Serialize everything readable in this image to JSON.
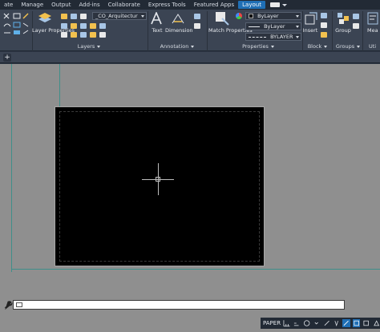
{
  "tabs": [
    {
      "label": "ate",
      "active": false
    },
    {
      "label": "Manage",
      "active": false
    },
    {
      "label": "Output",
      "active": false
    },
    {
      "label": "Add-ins",
      "active": false
    },
    {
      "label": "Collaborate",
      "active": false
    },
    {
      "label": "Express Tools",
      "active": false
    },
    {
      "label": "Featured Apps",
      "active": false
    },
    {
      "label": "Layout",
      "active": true
    }
  ],
  "layers": {
    "layer_properties_label": "Layer Properties",
    "current_layer": "_CO_Arquitectur",
    "panel_title": "Layers"
  },
  "annotation": {
    "text_label": "Text",
    "dimension_label": "Dimension",
    "panel_title": "Annotation"
  },
  "properties": {
    "match_label": "Match Properties",
    "color": "ByLayer",
    "linetype": "ByLayer",
    "lineweight": "BYLAYER",
    "panel_title": "Properties"
  },
  "block": {
    "insert_label": "Insert",
    "panel_title": "Block"
  },
  "groups": {
    "group_label": "Group",
    "panel_title": "Groups"
  },
  "utilities": {
    "measure_label": "Mea",
    "panel_title": "Uti"
  },
  "status": {
    "space": "PAPER"
  },
  "colors": {
    "accent": "#1f6fb5",
    "ribbon": "#3b4453",
    "canvas": "#8f8f8f",
    "margin": "#3f8f8a"
  }
}
